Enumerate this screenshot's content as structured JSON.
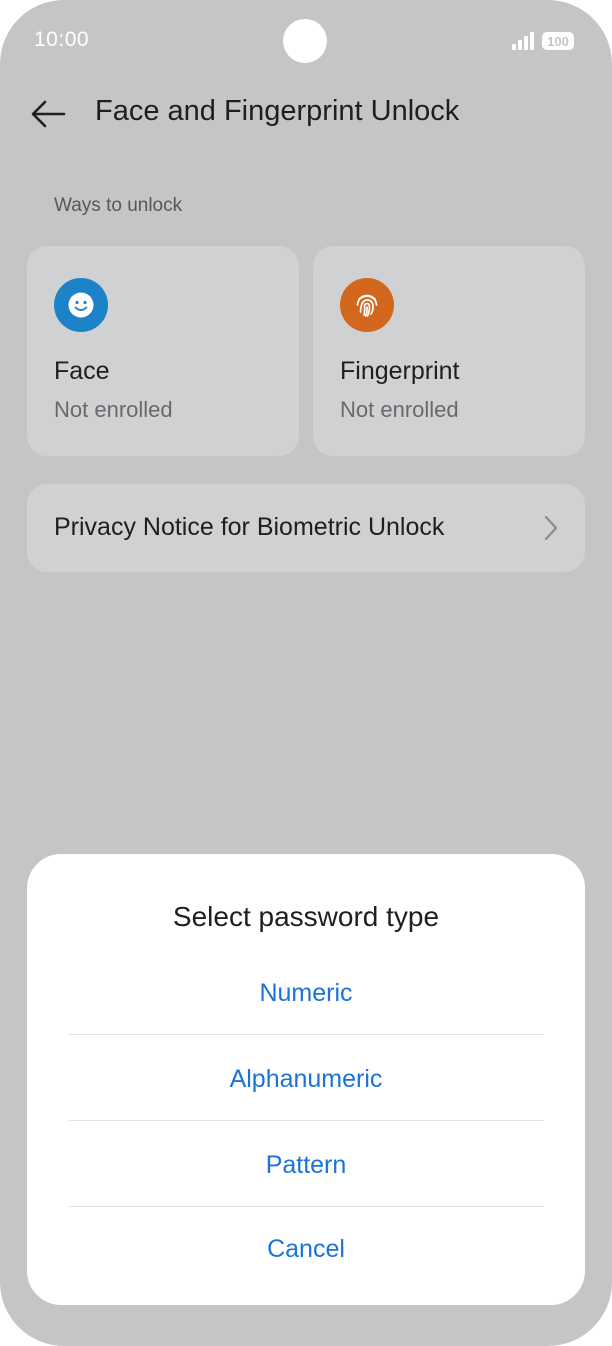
{
  "status_bar": {
    "time": "10:00",
    "battery": "100"
  },
  "header": {
    "title": "Face and Fingerprint Unlock",
    "back_icon": "arrow-left-icon"
  },
  "section": {
    "label": "Ways to unlock"
  },
  "cards": [
    {
      "title": "Face",
      "status": "Not enrolled",
      "icon": "face-icon",
      "color": "#1d83c9"
    },
    {
      "title": "Fingerprint",
      "status": "Not enrolled",
      "icon": "fingerprint-icon",
      "color": "#d4671e"
    }
  ],
  "privacy": {
    "label": "Privacy Notice for Biometric Unlock",
    "icon": "chevron-right-icon"
  },
  "dialog": {
    "title": "Select password type",
    "options": [
      "Numeric",
      "Alphanumeric",
      "Pattern"
    ],
    "cancel": "Cancel",
    "accent": "#1a73d9"
  }
}
